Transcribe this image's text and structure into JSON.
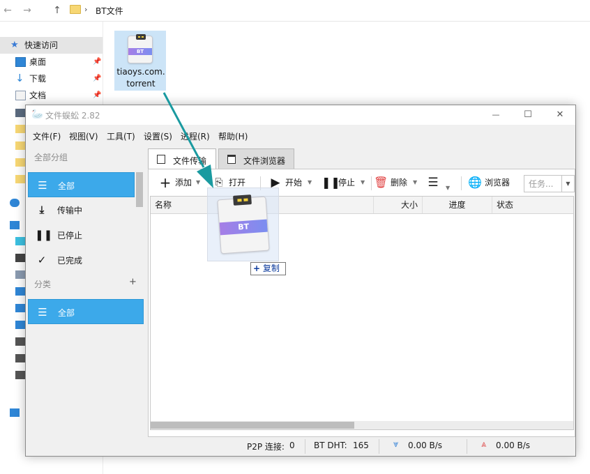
{
  "explorer": {
    "breadcrumb": "BT文件",
    "nav": {
      "back": "←",
      "forward": "→",
      "up": "↑"
    },
    "quick_access": {
      "label": "快速访问",
      "items": [
        {
          "label": "桌面",
          "pinned": true
        },
        {
          "label": "下载",
          "pinned": true
        },
        {
          "label": "文档",
          "pinned": true
        }
      ]
    },
    "file": {
      "name": "tiaoys.com.torrent",
      "badge": "BT"
    }
  },
  "app": {
    "title": "文件蜈蚣 2.82",
    "window_controls": {
      "minimize": "—",
      "maximize": "☐",
      "close": "✕"
    },
    "menu": [
      "文件(F)",
      "视图(V)",
      "工具(T)",
      "设置(S)",
      "进程(R)",
      "帮助(H)"
    ],
    "sidebar": {
      "groups_header": "全部分组",
      "groups": [
        {
          "label": "全部",
          "icon": "list-icon",
          "active": true
        },
        {
          "label": "传输中",
          "icon": "download-icon",
          "active": false
        },
        {
          "label": "已停止",
          "icon": "pause-icon",
          "active": false
        },
        {
          "label": "已完成",
          "icon": "check-icon",
          "active": false
        }
      ],
      "category_header": "分类",
      "category_add": "+",
      "categories": [
        {
          "label": "全部",
          "icon": "list-icon",
          "active": true
        }
      ]
    },
    "tabs": [
      {
        "label": "文件传输",
        "active": true
      },
      {
        "label": "文件浏览器",
        "active": false
      }
    ],
    "toolbar": {
      "add": "添加",
      "open": "打开",
      "start": "开始",
      "stop": "停止",
      "delete": "删除",
      "browser": "浏览器",
      "task_filter_placeholder": "任务..."
    },
    "table": {
      "columns": [
        "名称",
        "大小",
        "进度",
        "状态"
      ],
      "rows": []
    },
    "statusbar": {
      "p2p_label": "P2P 连接:",
      "p2p_value": "0",
      "dht_label": "BT DHT:",
      "dht_value": "165",
      "download_speed": "0.00 B/s",
      "upload_speed": "0.00 B/s"
    }
  },
  "drag": {
    "badge": "BT",
    "copy_tip": "复制",
    "copy_symbol": "+"
  },
  "colors": {
    "accent": "#3ca9ea",
    "arrow": "#1a9aa0",
    "download": "#3a86d8",
    "upload": "#e05a5a",
    "delete": "#e04040"
  }
}
